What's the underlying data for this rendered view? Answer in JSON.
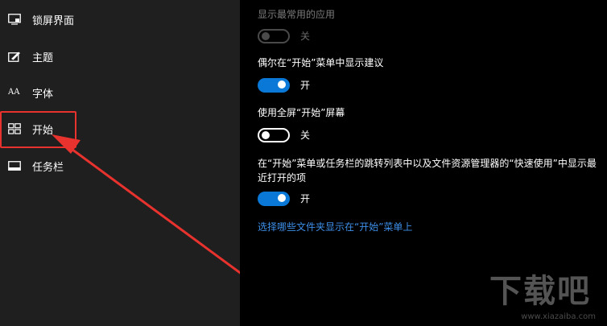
{
  "sidebar": {
    "items": [
      {
        "label": "锁屏界面",
        "icon": "lock-screen-icon"
      },
      {
        "label": "主题",
        "icon": "theme-brush-icon"
      },
      {
        "label": "字体",
        "icon": "font-icon"
      },
      {
        "label": "开始",
        "icon": "start-menu-icon"
      },
      {
        "label": "任务栏",
        "icon": "taskbar-icon"
      }
    ],
    "font_icon_glyph": "AA"
  },
  "main": {
    "settings": [
      {
        "title": "显示最常用的应用",
        "state": "关",
        "enabled": false,
        "on": false
      },
      {
        "title": "偶尔在“开始”菜单中显示建议",
        "state": "开",
        "enabled": true,
        "on": true
      },
      {
        "title": "使用全屏“开始”屏幕",
        "state": "关",
        "enabled": true,
        "on": false
      },
      {
        "title": "在“开始”菜单或任务栏的跳转列表中以及文件资源管理器的“快速使用”中显示最近打开的项",
        "state": "开",
        "enabled": true,
        "on": true
      }
    ],
    "link_label": "选择哪些文件夹显示在“开始”菜单上"
  },
  "annotation": {
    "color": "#e8322e"
  },
  "colors": {
    "accent": "#0a78d7",
    "link": "#3d8ee8",
    "sidebar_bg": "#1f1f1f",
    "main_bg": "#000000"
  },
  "watermark": {
    "logo_text": "下载吧",
    "url": "www.xiazaiba.com"
  }
}
